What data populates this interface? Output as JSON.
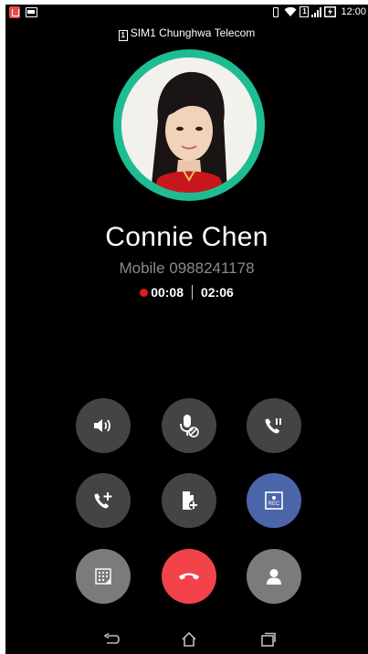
{
  "status_bar": {
    "time": "12:00",
    "sim_indicator": "1",
    "icons": [
      "notification-icon",
      "image-notification-icon",
      "vibrate-icon",
      "wifi-icon",
      "sim-icon",
      "signal-icon",
      "battery-charging-icon"
    ]
  },
  "sim": {
    "badge": "1",
    "label": "SIM1 Chunghwa Telecom"
  },
  "caller": {
    "name": "Connie Chen",
    "number": "Mobile 0988241178"
  },
  "timers": {
    "recording": "00:08",
    "call_duration": "02:06"
  },
  "controls": {
    "row1": [
      "speaker-icon",
      "mute-icon",
      "hold-icon"
    ],
    "row2": [
      "add-call-icon",
      "note-icon",
      "record-icon"
    ],
    "row3": [
      "keypad-icon",
      "end-call-icon",
      "contacts-icon"
    ],
    "record_label": "REC"
  },
  "colors": {
    "background": "#000000",
    "avatar_ring": "#1ebc92",
    "button": "#444444",
    "record_button": "#4a66a8",
    "end_call": "#f2434b",
    "secondary_button": "#7b7b7b",
    "recording_dot": "#e01b1b"
  },
  "navbar": {
    "icons": [
      "back-icon",
      "home-icon",
      "recents-icon"
    ]
  }
}
